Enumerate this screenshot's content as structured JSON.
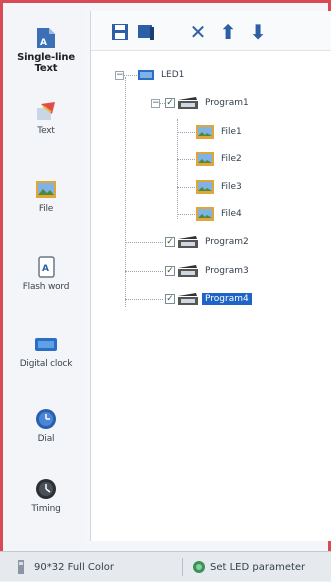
{
  "tools": [
    {
      "label": "Single-line Text",
      "icon": "single-line-text-icon"
    },
    {
      "label": "Text",
      "icon": "text-icon"
    },
    {
      "label": "File",
      "icon": "file-icon"
    },
    {
      "label": "Flash word",
      "icon": "flash-word-icon"
    },
    {
      "label": "Digital clock",
      "icon": "digital-clock-icon"
    },
    {
      "label": "Dial",
      "icon": "dial-icon"
    },
    {
      "label": "Timing",
      "icon": "timing-icon"
    }
  ],
  "toolbar": {
    "buttons": [
      "save-icon",
      "screen-icon",
      "delete-icon",
      "move-up-icon",
      "move-down-icon"
    ],
    "delete_glyph": "✕",
    "up_glyph": "⬆",
    "down_glyph": "⬇"
  },
  "tree": {
    "root": "LED1",
    "program1": "Program1",
    "files": [
      "File1",
      "File2",
      "File3",
      "File4"
    ],
    "program2": "Program2",
    "program3": "Program3",
    "program4": "Program4"
  },
  "status": {
    "display": "90*32 Full Color",
    "action": "Set LED parameter"
  },
  "colors": {
    "accent": "#1e63c6",
    "frame_border": "#d94a55"
  }
}
